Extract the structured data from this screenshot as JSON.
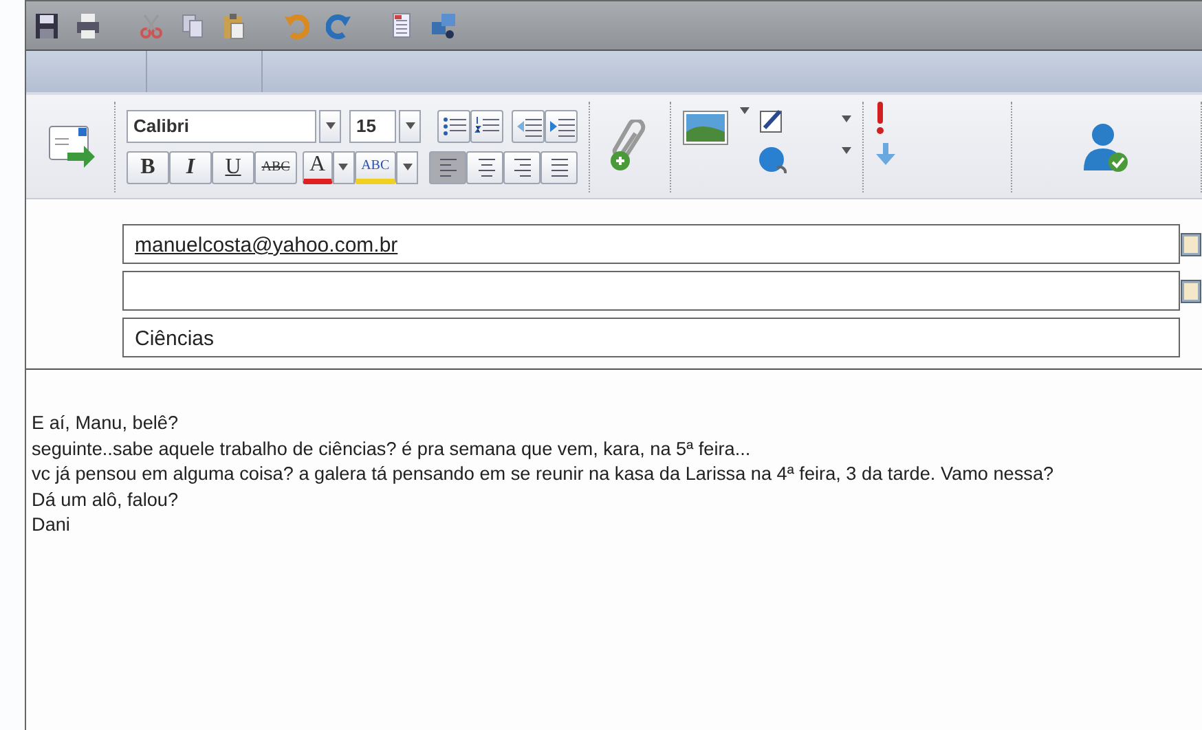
{
  "font": {
    "family": "Calibri",
    "size": "15"
  },
  "format_buttons": [
    {
      "kind": "bold",
      "label": "B"
    },
    {
      "kind": "italic",
      "label": "I"
    },
    {
      "kind": "underline",
      "label": "U"
    },
    {
      "kind": "strikethrough",
      "label": "ABC"
    }
  ],
  "font_color_button": {
    "label": "A"
  },
  "highlight_button": {
    "label": "ABC"
  },
  "alignment": [
    {
      "selected": true
    },
    {
      "selected": false
    },
    {
      "selected": false
    },
    {
      "selected": false
    }
  ],
  "fields": [
    {
      "kind": "recipient",
      "value": "manuelcosta@yahoo.com.br",
      "underlined": true
    },
    {
      "kind": "recipient"
    },
    {
      "kind": "subject",
      "value": "Ciências",
      "underlined": false
    }
  ],
  "body": [
    "E aí, Manu, belê?",
    "seguinte..sabe aquele trabalho de ciências? é pra semana que vem, kara, na 5ª feira...",
    "vc já pensou em alguma coisa? a galera tá pensando em se reunir na kasa da Larissa na 4ª feira, 3 da tarde. Vamo nessa?",
    "Dá um alô, falou?",
    "Dani"
  ]
}
